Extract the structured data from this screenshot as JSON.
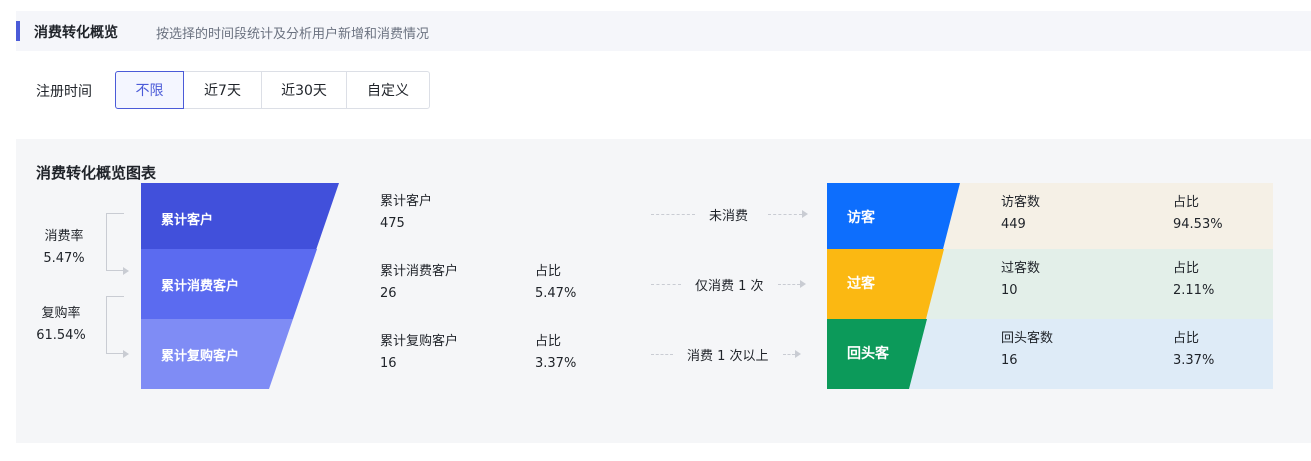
{
  "header": {
    "title": "消费转化概览",
    "description": "按选择的时间段统计及分析用户新增和消费情况"
  },
  "filter": {
    "label": "注册时间",
    "options": [
      "不限",
      "近7天",
      "近30天",
      "自定义"
    ],
    "selected": "不限"
  },
  "panel": {
    "title": "消费转化概览图表"
  },
  "rates": [
    {
      "label": "消费率",
      "value": "5.47%"
    },
    {
      "label": "复购率",
      "value": "61.54%"
    }
  ],
  "funnel": [
    {
      "label": "累计客户",
      "color": "#4150db"
    },
    {
      "label": "累计消费客户",
      "color": "#5b6bf0"
    },
    {
      "label": "累计复购客户",
      "color": "#7f8cf5"
    }
  ],
  "metrics": [
    {
      "label": "累计客户",
      "value": "475"
    },
    {
      "label": "累计消费客户",
      "value": "26",
      "ratio_label": "占比",
      "ratio": "5.47%"
    },
    {
      "label": "累计复购客户",
      "value": "16",
      "ratio_label": "占比",
      "ratio": "3.37%"
    }
  ],
  "connectors": [
    "未消费",
    "仅消费 1 次",
    "消费 1 次以上"
  ],
  "segments": [
    {
      "name": "访客",
      "color": "#0d6efd",
      "bg": "#f5f0e6",
      "count_label": "访客数",
      "count": "449",
      "ratio_label": "占比",
      "ratio": "94.53%"
    },
    {
      "name": "过客",
      "color": "#fbb812",
      "bg": "#e3efe9",
      "count_label": "过客数",
      "count": "10",
      "ratio_label": "占比",
      "ratio": "2.11%"
    },
    {
      "name": "回头客",
      "color": "#0c9a5a",
      "bg": "#deebf7",
      "count_label": "回头客数",
      "count": "16",
      "ratio_label": "占比",
      "ratio": "3.37%"
    }
  ]
}
